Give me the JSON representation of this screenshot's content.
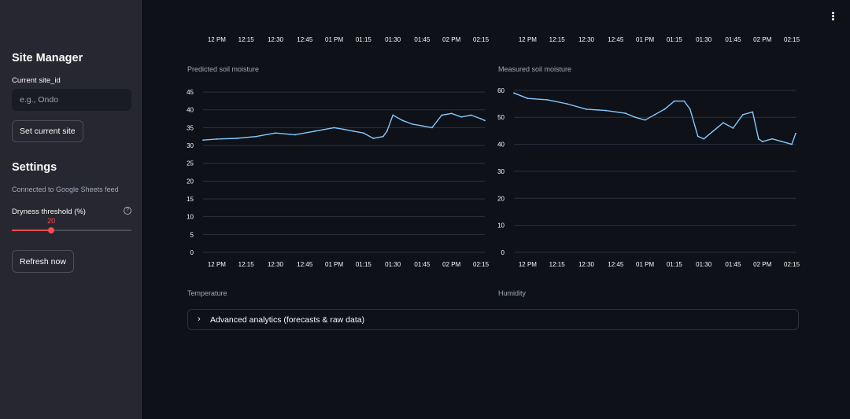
{
  "sidebar": {
    "site_manager_title": "Site Manager",
    "current_site_label": "Current site_id",
    "site_input_placeholder": "e.g., Ondo",
    "site_input_value": "",
    "set_site_button": "Set current site",
    "settings_title": "Settings",
    "connection_caption": "Connected to Google Sheets feed",
    "dryness_label": "Dryness threshold (%)",
    "dryness_value": "20",
    "dryness_fraction": 0.33,
    "refresh_button": "Refresh now",
    "accent_color": "#ff4b4b"
  },
  "main": {
    "menu_icon": "more-vertical-icon",
    "temperature_title": "Temperature",
    "humidity_title": "Humidity",
    "expander_label": "Advanced analytics (forecasts & raw data)",
    "expander_icon": "chevron-right-icon",
    "top_time_labels": [
      "12 PM",
      "12:15",
      "12:30",
      "12:45",
      "01 PM",
      "01:15",
      "01:30",
      "01:45",
      "02 PM",
      "02:15"
    ]
  },
  "chart_data": [
    {
      "type": "line",
      "title": "Predicted soil moisture",
      "x": [
        "11:53",
        "12:00",
        "12:10",
        "12:20",
        "12:30",
        "12:40",
        "12:50",
        "01:00",
        "01:05",
        "01:10",
        "01:15",
        "01:20",
        "01:25",
        "01:27",
        "01:30",
        "01:35",
        "01:40",
        "01:45",
        "01:50",
        "01:55",
        "02:00",
        "02:05",
        "02:10",
        "02:15",
        "02:17"
      ],
      "x_tick_labels": [
        "12 PM",
        "12:15",
        "12:30",
        "12:45",
        "01 PM",
        "01:15",
        "01:30",
        "01:45",
        "02 PM",
        "02:15"
      ],
      "y_ticks": [
        0,
        5,
        10,
        15,
        20,
        25,
        30,
        35,
        40,
        45
      ],
      "ylim": [
        0,
        47
      ],
      "series": [
        {
          "values": [
            31.5,
            31.8,
            32,
            32.5,
            33.5,
            33,
            34,
            35,
            34.5,
            34,
            33.5,
            32,
            32.5,
            34,
            38.5,
            37,
            36,
            35.5,
            35,
            38.5,
            39,
            38,
            38.5,
            37.5,
            37
          ],
          "color": "#83c9ff"
        }
      ],
      "grid": true
    },
    {
      "type": "line",
      "title": "Measured soil moisture",
      "x": [
        "11:53",
        "12:00",
        "12:10",
        "12:20",
        "12:30",
        "12:40",
        "12:50",
        "12:55",
        "01:00",
        "01:05",
        "01:10",
        "01:15",
        "01:20",
        "01:23",
        "01:27",
        "01:30",
        "01:35",
        "01:40",
        "01:45",
        "01:50",
        "01:55",
        "01:58",
        "02:00",
        "02:05",
        "02:10",
        "02:15",
        "02:17"
      ],
      "x_tick_labels": [
        "12 PM",
        "12:15",
        "12:30",
        "12:45",
        "01 PM",
        "01:15",
        "01:30",
        "01:45",
        "02 PM",
        "02:15"
      ],
      "y_ticks": [
        0,
        10,
        20,
        30,
        40,
        50,
        60
      ],
      "ylim": [
        0,
        62
      ],
      "series": [
        {
          "values": [
            59,
            57,
            56.5,
            55,
            53,
            52.5,
            51.5,
            50,
            49,
            51,
            53,
            56,
            56,
            53,
            43,
            42,
            45,
            48,
            46,
            51,
            52,
            42,
            41,
            42,
            41,
            40,
            44
          ],
          "color": "#83c9ff"
        }
      ],
      "grid": true
    }
  ]
}
